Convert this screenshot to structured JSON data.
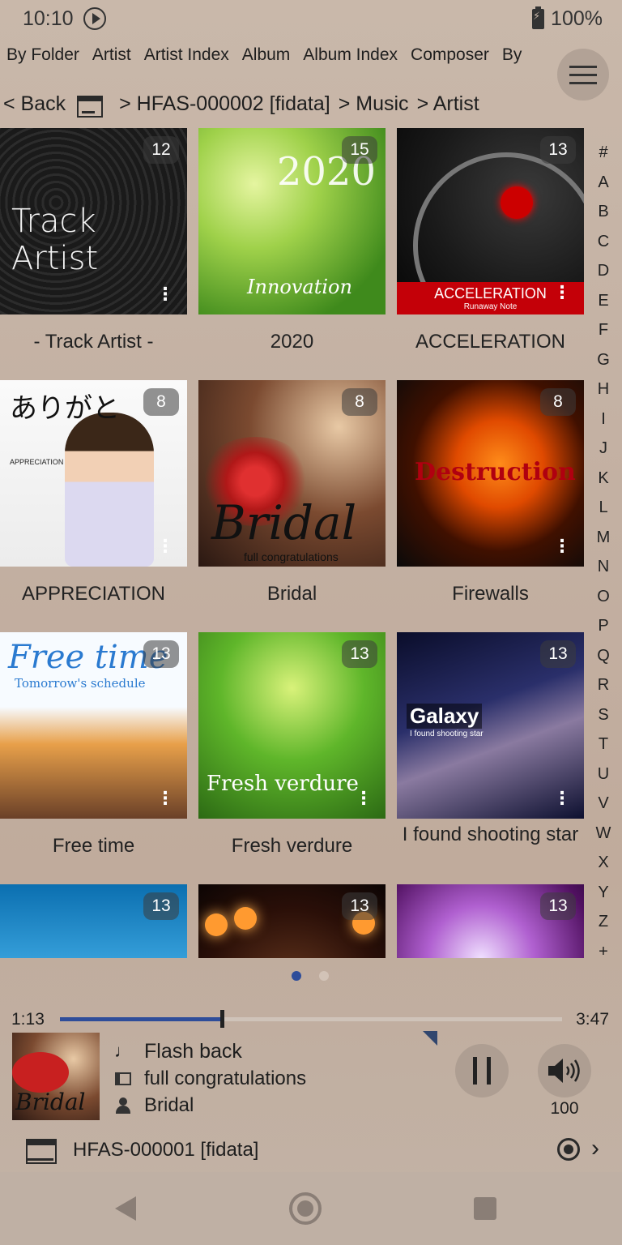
{
  "status": {
    "time": "10:10",
    "battery": "100%"
  },
  "tabs": [
    "By Folder",
    "Artist",
    "Artist Index",
    "Album",
    "Album Index",
    "Composer",
    "By"
  ],
  "breadcrumb": {
    "back_label": "< Back",
    "segments": [
      "> HFAS-000002 [fidata]",
      "> Music",
      "> Artist"
    ]
  },
  "grid": [
    {
      "title": "- Track Artist -",
      "count": "12",
      "art_text": "Track Artist"
    },
    {
      "title": "2020",
      "count": "15",
      "art_text": "2020",
      "art_sub": "Innovation"
    },
    {
      "title": "ACCELERATION",
      "count": "13",
      "art_text": "ACCELERATION",
      "art_sub": "Runaway Note"
    },
    {
      "title": "APPRECIATION",
      "count": "8",
      "art_text": "ありがと",
      "art_sub": "APPRECIATION"
    },
    {
      "title": "Bridal",
      "count": "8",
      "art_text": "Bridal",
      "art_sub": "full congratulations"
    },
    {
      "title": "Firewalls",
      "count": "8",
      "art_text": "Destruction"
    },
    {
      "title": "Free time",
      "count": "13",
      "art_text": "Free time",
      "art_sub": "Tomorrow's schedule"
    },
    {
      "title": "Fresh verdure",
      "count": "13",
      "art_text": "Fresh verdure"
    },
    {
      "title": "I found shooting star",
      "count": "13",
      "art_text": "Galaxy",
      "art_sub": "I found shooting star"
    },
    {
      "title": "",
      "count": "13"
    },
    {
      "title": "",
      "count": "13"
    },
    {
      "title": "",
      "count": "13"
    }
  ],
  "alphabet": [
    "#",
    "A",
    "B",
    "C",
    "D",
    "E",
    "F",
    "G",
    "H",
    "I",
    "J",
    "K",
    "L",
    "M",
    "N",
    "O",
    "P",
    "Q",
    "R",
    "S",
    "T",
    "U",
    "V",
    "W",
    "X",
    "Y",
    "Z",
    "+"
  ],
  "pager": {
    "pages": 2,
    "active": 0
  },
  "player": {
    "elapsed": "1:13",
    "total": "3:47",
    "progress": 0.322,
    "track": "Flash back",
    "album": "full congratulations",
    "artist": "Bridal",
    "art_text": "Bridal",
    "volume": "100"
  },
  "device": {
    "name": "HFAS-000001 [fidata]"
  },
  "icons": {
    "play_status": "play-circle-icon",
    "battery": "battery-charging-icon",
    "menu": "hamburger-icon",
    "monitor": "monitor-icon",
    "note": "music-note-icon",
    "album": "album-icon",
    "person": "person-icon",
    "pause": "pause-icon",
    "volume": "speaker-icon",
    "cast": "cast-icon",
    "chevron": "chevron-right-icon"
  },
  "colors": {
    "accent": "#2e4d9a",
    "background": "#c3b0a2"
  }
}
